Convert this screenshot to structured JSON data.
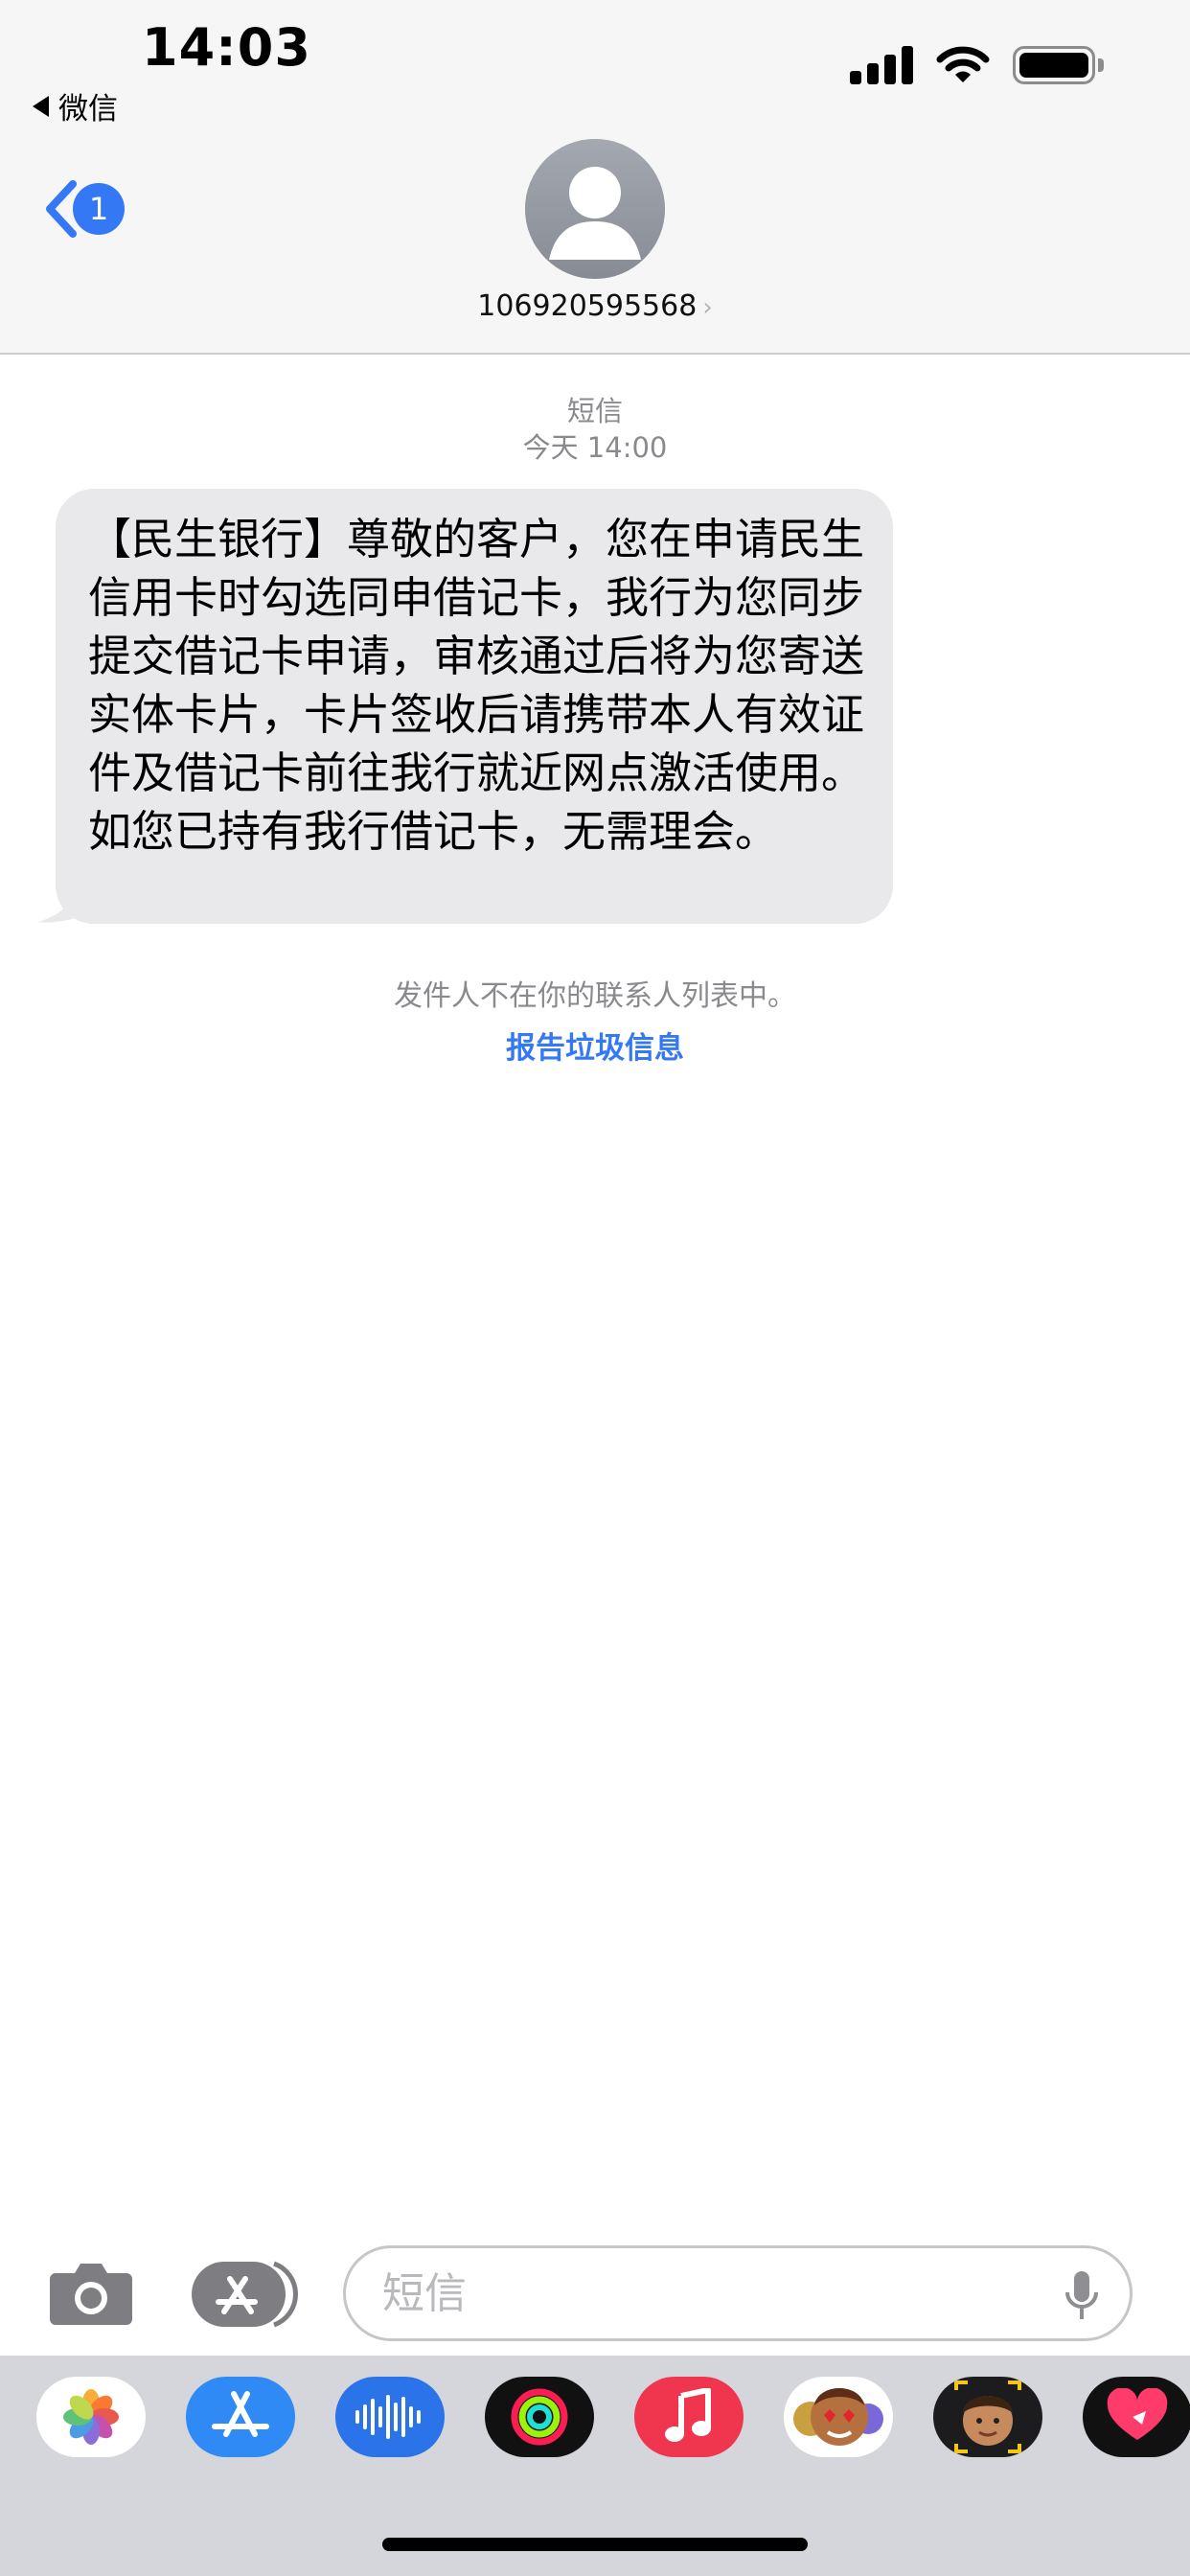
{
  "status_bar": {
    "time": "14:03",
    "back_app_label": "微信"
  },
  "nav": {
    "unread_count": "1",
    "contact_number": "106920595568",
    "chevron": "›"
  },
  "conversation": {
    "service_label": "短信",
    "timestamp": "今天 14:00",
    "message": "【民生银行】尊敬的客户，您在申请民生信用卡时勾选同申借记卡，我行为您同步提交借记卡申请，审核通过后将为您寄送实体卡片，卡片签收后请携带本人有效证件及借记卡前往我行就近网点激活使用。如您已持有我行借记卡，无需理会。",
    "unknown_sender_notice": "发件人不在你的联系人列表中。",
    "report_junk": "报告垃圾信息"
  },
  "composer": {
    "placeholder": "短信"
  },
  "app_drawer": {
    "apps": [
      {
        "icon": "photos-icon"
      },
      {
        "icon": "app-store-icon"
      },
      {
        "icon": "audio-message-icon"
      },
      {
        "icon": "fitness-icon"
      },
      {
        "icon": "music-icon"
      },
      {
        "icon": "memoji-stickers-icon"
      },
      {
        "icon": "memoji-icon"
      },
      {
        "icon": "digital-touch-icon"
      }
    ]
  },
  "colors": {
    "accent": "#3478f6",
    "bubble": "#e9e9eb",
    "meta_text": "#8a8a8e"
  }
}
